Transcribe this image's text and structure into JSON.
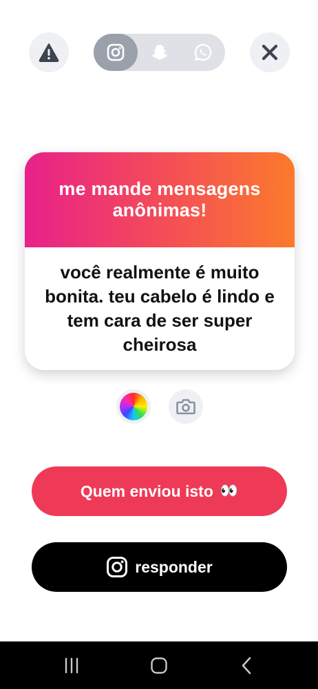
{
  "top_bar": {
    "report_icon": "alert-triangle-icon",
    "close_icon": "close-icon",
    "platforms": [
      {
        "name": "instagram",
        "icon": "instagram-icon",
        "active": true
      },
      {
        "name": "snapchat",
        "icon": "snapchat-icon",
        "active": false
      },
      {
        "name": "whatsapp",
        "icon": "whatsapp-icon",
        "active": false
      }
    ]
  },
  "card": {
    "title": "me mande mensagens anônimas!",
    "message": "você realmente é muito bonita. teu cabelo é lindo e tem cara de ser super cheirosa",
    "gradient": [
      "#e8218b",
      "#fb7a2c"
    ]
  },
  "tools": {
    "color_picker_icon": "color-wheel-icon",
    "camera_icon": "camera-icon"
  },
  "actions": {
    "who_sent_label": "Quem enviou isto",
    "who_sent_emoji": "👀",
    "who_sent_color": "#ee3a57",
    "reply_label": "responder",
    "reply_icon": "instagram-icon",
    "reply_color": "#000000"
  },
  "system_nav": {
    "recents_icon": "recents-icon",
    "home_icon": "home-icon",
    "back_icon": "back-icon"
  }
}
